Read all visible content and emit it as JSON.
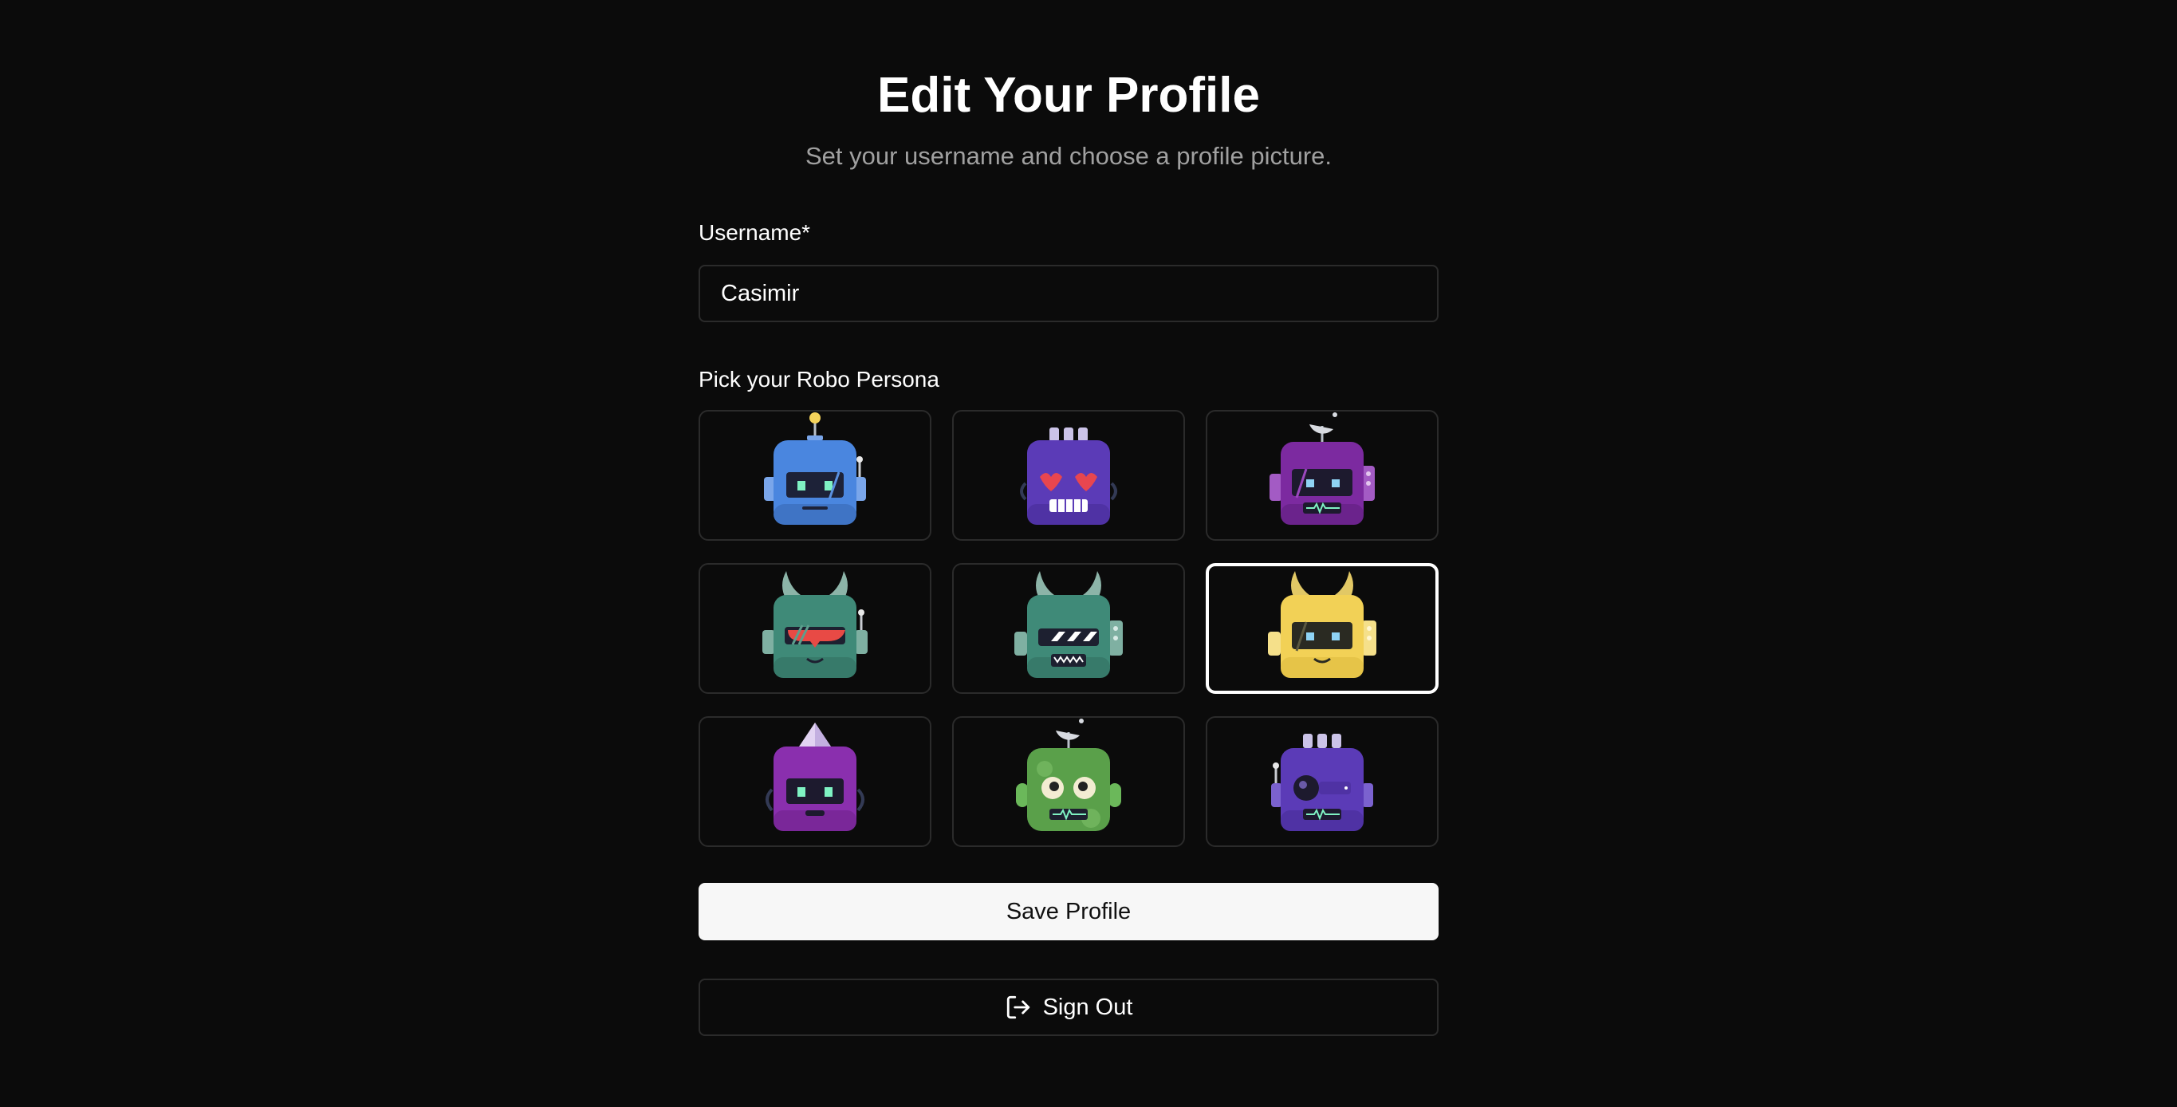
{
  "page": {
    "title": "Edit Your Profile",
    "subtitle": "Set your username and choose a profile picture."
  },
  "username": {
    "label": "Username*",
    "value": "Casimir"
  },
  "persona": {
    "label": "Pick your Robo Persona",
    "selected_index": 5,
    "avatars": [
      {
        "name": "blue-robot",
        "color": "#4a86df"
      },
      {
        "name": "purple-heart-eyes-robot",
        "color": "#5b3bb7"
      },
      {
        "name": "magenta-dish-robot",
        "color": "#7c2aa0"
      },
      {
        "name": "teal-horned-visor-robot",
        "color": "#3f8a78"
      },
      {
        "name": "teal-horned-striped-robot",
        "color": "#3f8a78"
      },
      {
        "name": "yellow-horned-robot",
        "color": "#f2d156"
      },
      {
        "name": "purple-crystal-robot",
        "color": "#8a2fae"
      },
      {
        "name": "green-googly-eyes-robot",
        "color": "#5aa04a"
      },
      {
        "name": "indigo-one-eye-robot",
        "color": "#5b3bb7"
      }
    ]
  },
  "actions": {
    "save_label": "Save Profile",
    "signout_label": "Sign Out",
    "signout_icon": "logout-icon"
  }
}
